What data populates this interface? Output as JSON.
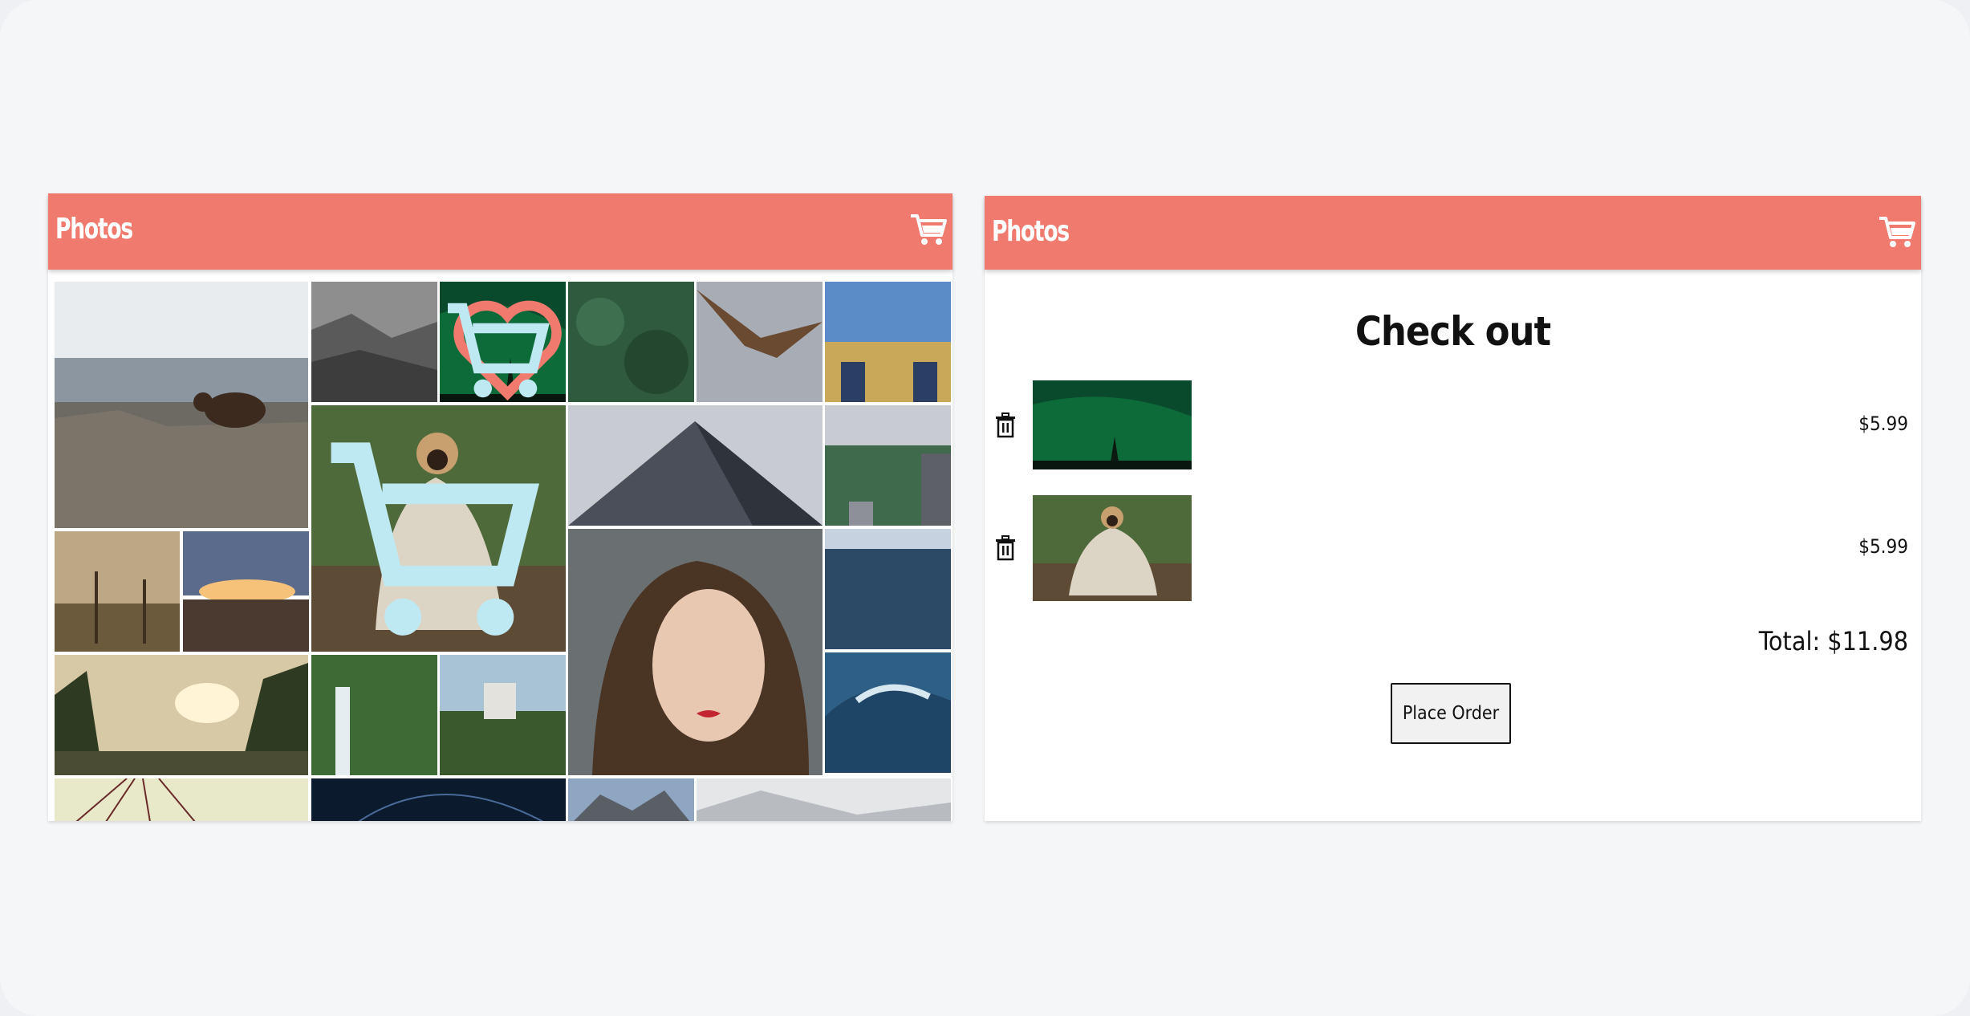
{
  "left_app": {
    "header": {
      "title": "Photos",
      "cart_icon": "cart-icon"
    },
    "colors": {
      "header": "#f07a6e"
    },
    "gallery": {
      "photos": [
        "bear-on-rocky-hill",
        "misty-forest-mountains",
        "green-aurora-night",
        "pine-forest-aerial",
        "eagle-in-flight",
        "feet-in-grass-field",
        "pug-in-blanket",
        "skyscraper-looking-up",
        "city-park-aerial",
        "foggy-dead-trees",
        "sunset-over-rails",
        "woman-portrait",
        "ocean-waves",
        "mountain-valley-sunset",
        "waterfall-cliff",
        "castle-on-hill",
        "crashing-wave",
        "hanging-ornaments",
        "star-trails",
        "rocky-mountains",
        "foggy-hills"
      ]
    }
  },
  "right_app": {
    "header": {
      "title": "Photos",
      "cart_icon": "cart-icon"
    },
    "checkout": {
      "title": "Check out",
      "items": [
        {
          "photo": "green-aurora-night",
          "price": "$5.99"
        },
        {
          "photo": "pug-in-blanket",
          "price": "$5.99"
        }
      ],
      "total": "Total: $11.98",
      "place_order_label": "Place Order"
    }
  }
}
